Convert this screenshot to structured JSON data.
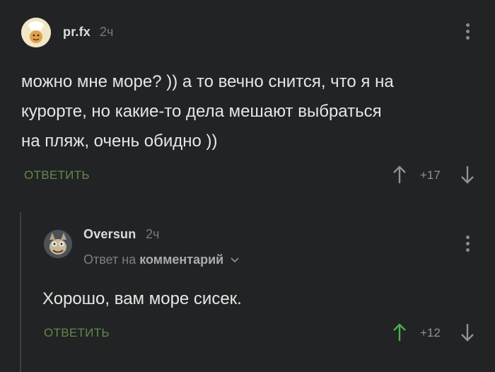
{
  "comments": [
    {
      "author": "pr.fx",
      "time": "2ч",
      "text_lines": [
        "можно мне море? )) а то вечно снится, что я на",
        "курорте, но какие-то дела мешают выбраться",
        "на пляж, очень обидно ))"
      ],
      "reply_label": "ОТВЕТИТЬ",
      "rating": "+17"
    },
    {
      "author": "Oversun",
      "time": "2ч",
      "reply_prefix": "Ответ на",
      "reply_target": "комментарий",
      "text": "Хорошо, вам море сисек.",
      "reply_label": "ОТВЕТИТЬ",
      "rating": "+12"
    }
  ],
  "colors": {
    "background": "#222324",
    "reply_green": "#5f8a4f",
    "upvote_active": "#4caf50",
    "muted": "#8f9295"
  },
  "icons": [
    "kebab-menu-icon",
    "arrow-up-icon",
    "arrow-down-icon",
    "chevron-down-icon"
  ]
}
